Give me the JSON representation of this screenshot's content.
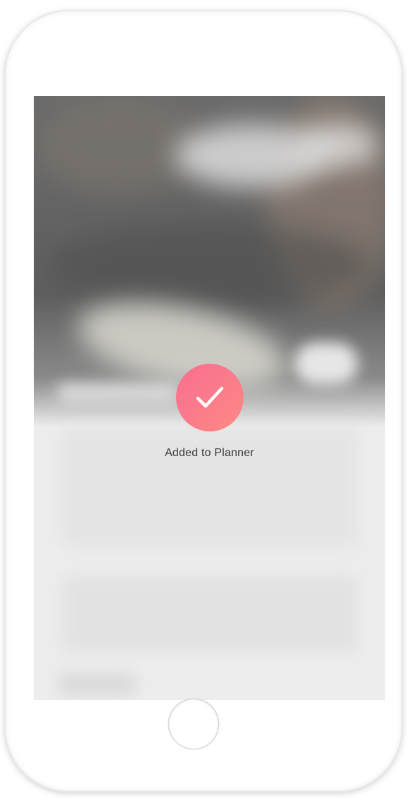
{
  "toast": {
    "message": "Added to Planner",
    "icon": "checkmark-icon"
  },
  "colors": {
    "accent_start": "#f96d92",
    "accent_end": "#fc8a83",
    "text": "#3a3a3a",
    "screen_background": "#ededed"
  },
  "device": {
    "home_button_icon": "home-button"
  }
}
